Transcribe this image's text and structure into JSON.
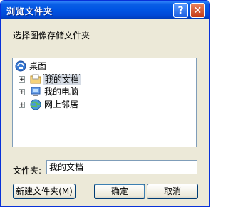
{
  "window": {
    "title": "浏览文件夹",
    "help_label": "?",
    "close_label": "✕"
  },
  "prompt": "选择图像存储文件夹",
  "tree": {
    "root": {
      "label": "桌面",
      "icon": "desktop-icon"
    },
    "items": [
      {
        "label": "我的文档",
        "icon": "my-documents-folder-icon",
        "expander": "+",
        "selected": true
      },
      {
        "label": "我的电脑",
        "icon": "my-computer-icon",
        "expander": "+",
        "selected": false
      },
      {
        "label": "网上邻居",
        "icon": "network-places-icon",
        "expander": "+",
        "selected": false
      }
    ]
  },
  "folder": {
    "label": "文件夹:",
    "value": "我的文档"
  },
  "buttons": {
    "new_folder": "新建文件夹(M)",
    "ok": "确定",
    "cancel": "取消"
  },
  "colors": {
    "titlebar": "#0054e3",
    "window_bg": "#ece9d8",
    "selection": "#d6dce5"
  }
}
